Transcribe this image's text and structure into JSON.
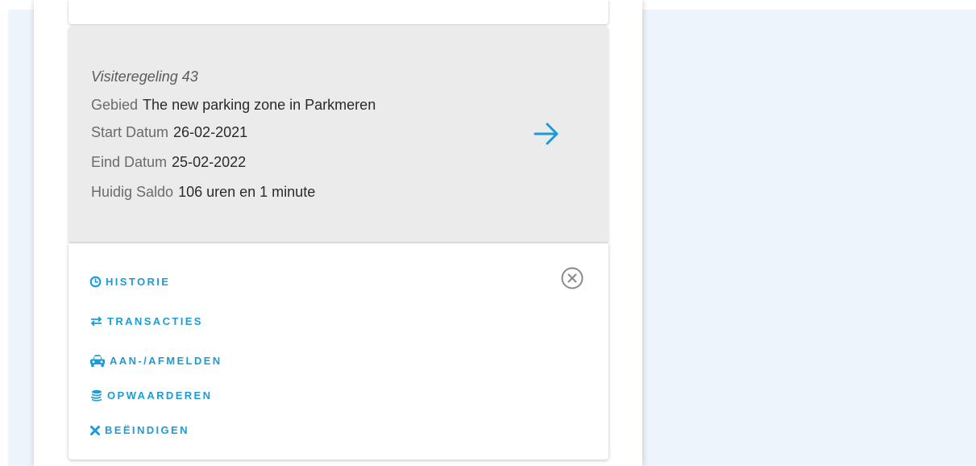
{
  "card": {
    "title": "Visiteregeling 43",
    "rows": [
      {
        "label": "Gebied",
        "value": "The new parking zone in Parkmeren"
      },
      {
        "label": "Start Datum",
        "value": "26-02-2021"
      },
      {
        "label": "Eind Datum",
        "value": "25-02-2022"
      },
      {
        "label": "Huidig Saldo",
        "value": "106 uren en 1 minute"
      }
    ],
    "arrow_icon": "arrow-right-icon"
  },
  "actions": [
    {
      "label": "HISTORIE",
      "icon": "clock-icon"
    },
    {
      "label": "TRANSACTIES",
      "icon": "exchange-icon"
    },
    {
      "label": "AAN-/AFMELDEN",
      "icon": "car-icon"
    },
    {
      "label": "OPWAARDEREN",
      "icon": "coins-icon"
    },
    {
      "label": "BEËINDIGEN",
      "icon": "times-icon"
    }
  ],
  "close_icon": "close-circle-icon",
  "colors": {
    "accent": "#1a9cd6",
    "card_bg": "#ebebeb",
    "page_bg": "#eef4fc"
  }
}
